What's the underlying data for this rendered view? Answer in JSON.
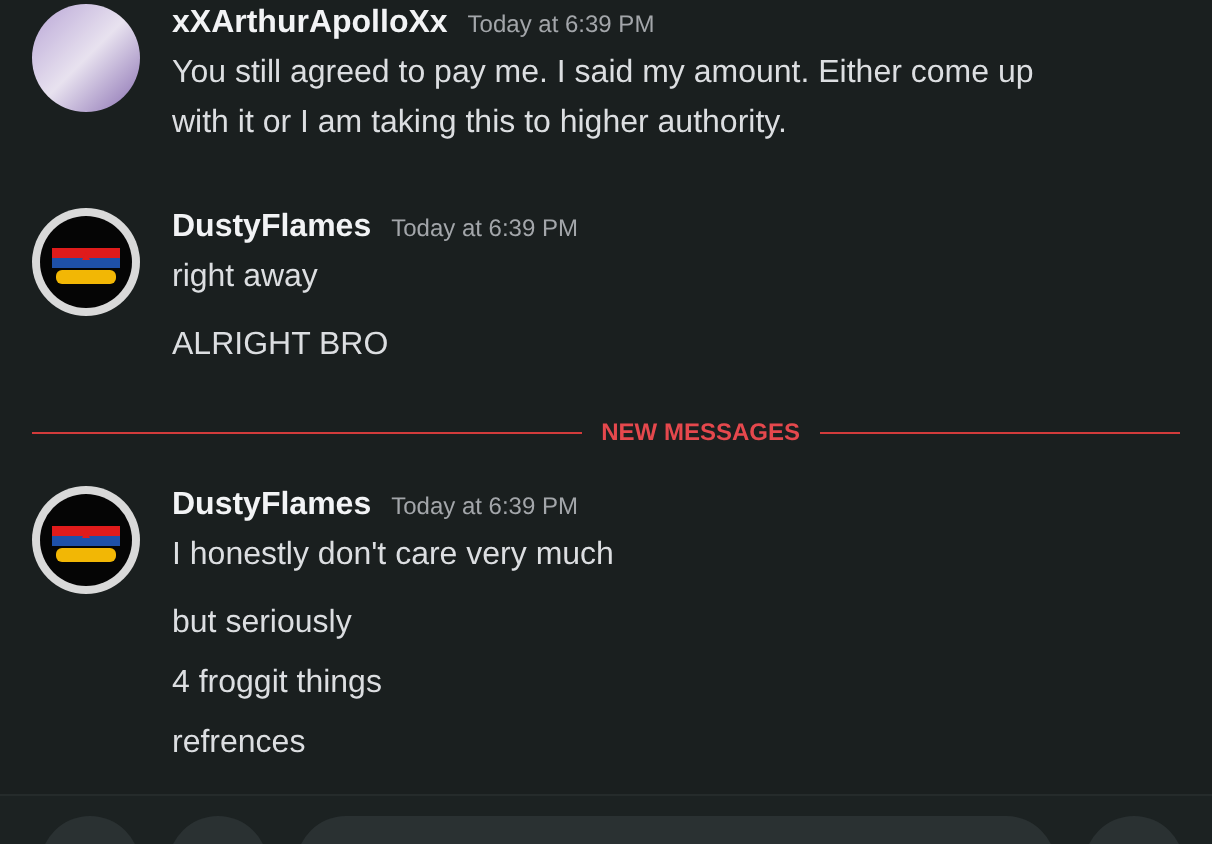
{
  "groups": [
    {
      "author": "xXArthurApolloXx",
      "timestamp": "Today at 6:39 PM",
      "avatar": {
        "kind": "picture"
      },
      "lines": [
        "You still agreed to pay me. I said my amount. Either come up with it or I am taking this to higher authority."
      ]
    },
    {
      "author": "DustyFlames",
      "timestamp": "Today at 6:39 PM",
      "avatar": {
        "kind": "striped"
      },
      "lines": [
        "right away",
        "ALRIGHT BRO"
      ]
    },
    {
      "divider": "NEW MESSAGES",
      "author": "DustyFlames",
      "timestamp": "Today at 6:39 PM",
      "avatar": {
        "kind": "striped"
      },
      "lines": [
        "I honestly don't care very much",
        "but seriously",
        "4 froggit things",
        "refrences"
      ]
    }
  ]
}
